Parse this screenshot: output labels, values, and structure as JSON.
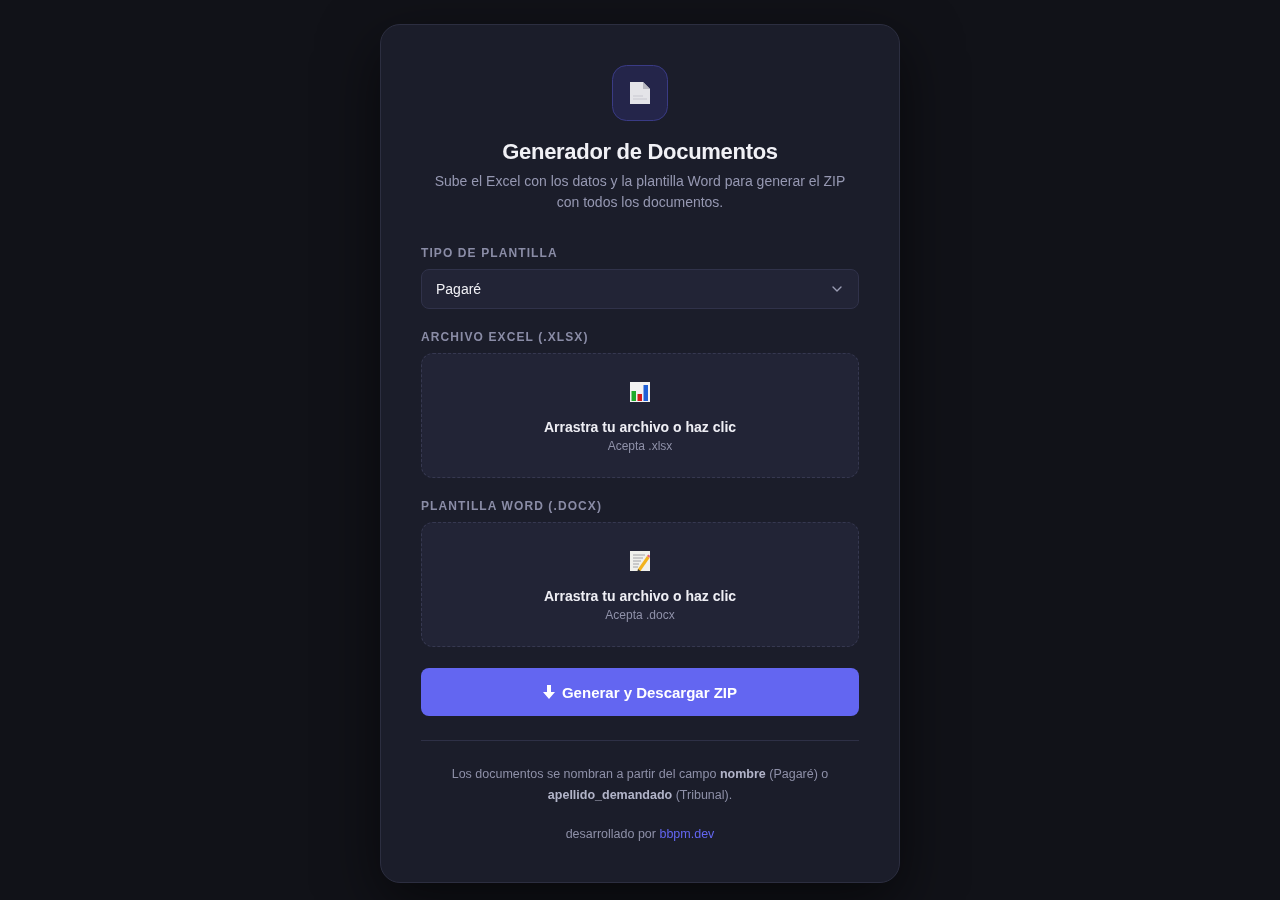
{
  "header": {
    "title": "Generador de Documentos",
    "subtitle": "Sube el Excel con los datos y la plantilla Word para generar el ZIP con todos los documentos."
  },
  "template_type": {
    "label": "TIPO DE PLANTILLA",
    "value": "Pagaré"
  },
  "uploads": [
    {
      "kind": "spreadsheet",
      "label": "ARCHIVO EXCEL (.XLSX)",
      "prompt": "Arrastra tu archivo o haz clic",
      "hint": "Acepta .xlsx"
    },
    {
      "kind": "document",
      "label": "PLANTILLA WORD (.DOCX)",
      "prompt": "Arrastra tu archivo o haz clic",
      "hint": "Acepta .docx"
    }
  ],
  "generate_button": {
    "label": "Generar y Descargar ZIP"
  },
  "footer": {
    "note": "Los documentos se nombran a partir del campo **nombre** (Pagaré) o **apellido_demandado** (Tribunal).",
    "credit": {
      "text": "desarrollado por",
      "link": "bbpm.dev"
    }
  }
}
